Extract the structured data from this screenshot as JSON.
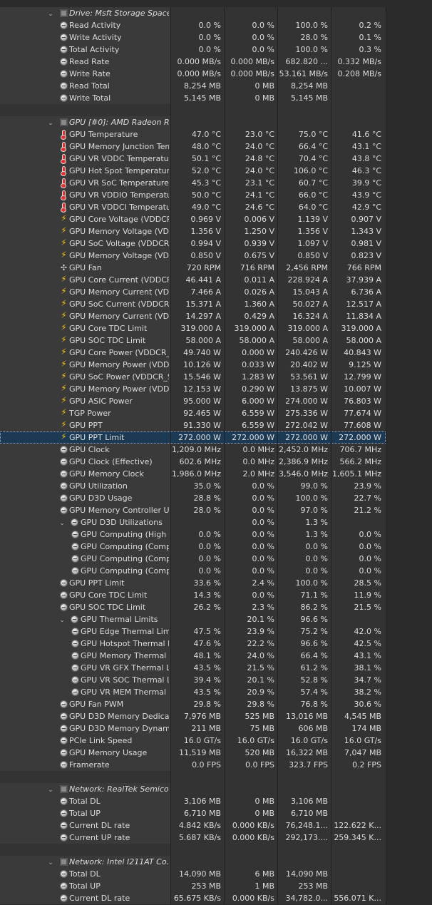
{
  "rows": [
    {
      "t": "section",
      "name": "Drive: Msft Storage Space...",
      "icon": "drive-icon"
    },
    {
      "t": "item",
      "icon": "sensor-circle-icon",
      "name": "Read Activity",
      "v": [
        "0.0 %",
        "0.0 %",
        "100.0 %",
        "0.2 %"
      ]
    },
    {
      "t": "item",
      "icon": "sensor-circle-icon",
      "name": "Write Activity",
      "v": [
        "0.0 %",
        "0.0 %",
        "28.0 %",
        "0.1 %"
      ]
    },
    {
      "t": "item",
      "icon": "sensor-circle-icon",
      "name": "Total Activity",
      "v": [
        "0.0 %",
        "0.0 %",
        "100.0 %",
        "0.3 %"
      ]
    },
    {
      "t": "item",
      "icon": "sensor-circle-icon",
      "name": "Read Rate",
      "v": [
        "0.000 MB/s",
        "0.000 MB/s",
        "682.820 ...",
        "0.332 MB/s"
      ]
    },
    {
      "t": "item",
      "icon": "sensor-circle-icon",
      "name": "Write Rate",
      "v": [
        "0.000 MB/s",
        "0.000 MB/s",
        "53.161 MB/s",
        "0.208 MB/s"
      ]
    },
    {
      "t": "item",
      "icon": "sensor-circle-icon",
      "name": "Read Total",
      "v": [
        "8,254 MB",
        "0 MB",
        "8,254 MB",
        ""
      ]
    },
    {
      "t": "item",
      "icon": "sensor-circle-icon",
      "name": "Write Total",
      "v": [
        "5,145 MB",
        "0 MB",
        "5,145 MB",
        ""
      ]
    },
    {
      "t": "blank"
    },
    {
      "t": "section",
      "name": "GPU [#0]: AMD Radeon R...",
      "icon": "gpu-chip-icon"
    },
    {
      "t": "item",
      "icon": "thermometer-icon",
      "name": "GPU Temperature",
      "v": [
        "47.0 °C",
        "23.0 °C",
        "75.0 °C",
        "41.6 °C"
      ]
    },
    {
      "t": "item",
      "icon": "thermometer-icon",
      "name": "GPU Memory Junction Tem...",
      "v": [
        "48.0 °C",
        "24.0 °C",
        "66.4 °C",
        "43.1 °C"
      ]
    },
    {
      "t": "item",
      "icon": "thermometer-icon",
      "name": "GPU VR VDDC Temperature",
      "v": [
        "50.1 °C",
        "24.8 °C",
        "70.4 °C",
        "43.8 °C"
      ]
    },
    {
      "t": "item",
      "icon": "thermometer-icon",
      "name": "GPU Hot Spot Temperature",
      "v": [
        "52.0 °C",
        "24.0 °C",
        "106.0 °C",
        "46.3 °C"
      ]
    },
    {
      "t": "item",
      "icon": "thermometer-icon",
      "name": "GPU VR SoC Temperature",
      "v": [
        "45.3 °C",
        "23.1 °C",
        "60.7 °C",
        "39.9 °C"
      ]
    },
    {
      "t": "item",
      "icon": "thermometer-icon",
      "name": "GPU VR VDDIO Temperature",
      "v": [
        "50.0 °C",
        "24.1 °C",
        "66.0 °C",
        "43.9 °C"
      ]
    },
    {
      "t": "item",
      "icon": "thermometer-icon",
      "name": "GPU VR VDDCI Temperature",
      "v": [
        "49.0 °C",
        "24.6 °C",
        "64.0 °C",
        "42.9 °C"
      ]
    },
    {
      "t": "item",
      "icon": "lightning-bolt-icon",
      "name": "GPU Core Voltage (VDDCR...",
      "v": [
        "0.969 V",
        "0.006 V",
        "1.139 V",
        "0.907 V"
      ]
    },
    {
      "t": "item",
      "icon": "lightning-bolt-icon",
      "name": "GPU Memory Voltage (VDD...",
      "v": [
        "1.356 V",
        "1.250 V",
        "1.356 V",
        "1.343 V"
      ]
    },
    {
      "t": "item",
      "icon": "lightning-bolt-icon",
      "name": "GPU SoC Voltage (VDDCR_...",
      "v": [
        "0.994 V",
        "0.939 V",
        "1.097 V",
        "0.981 V"
      ]
    },
    {
      "t": "item",
      "icon": "lightning-bolt-icon",
      "name": "GPU Memory Voltage (VDD...",
      "v": [
        "0.850 V",
        "0.675 V",
        "0.850 V",
        "0.823 V"
      ]
    },
    {
      "t": "item",
      "icon": "fan-icon",
      "name": "GPU Fan",
      "v": [
        "720 RPM",
        "716 RPM",
        "2,456 RPM",
        "766 RPM"
      ]
    },
    {
      "t": "item",
      "icon": "lightning-bolt-icon",
      "name": "GPU Core Current (VDDCR...",
      "v": [
        "46.441 A",
        "0.011 A",
        "228.924 A",
        "37.939 A"
      ]
    },
    {
      "t": "item",
      "icon": "lightning-bolt-icon",
      "name": "GPU Memory Current (VDD...",
      "v": [
        "7.466 A",
        "0.026 A",
        "15.043 A",
        "6.736 A"
      ]
    },
    {
      "t": "item",
      "icon": "lightning-bolt-icon",
      "name": "GPU SoC Current (VDDCR...",
      "v": [
        "15.371 A",
        "1.360 A",
        "50.027 A",
        "12.517 A"
      ]
    },
    {
      "t": "item",
      "icon": "lightning-bolt-icon",
      "name": "GPU Memory Current (VDD...",
      "v": [
        "14.297 A",
        "0.429 A",
        "16.324 A",
        "11.834 A"
      ]
    },
    {
      "t": "item",
      "icon": "lightning-bolt-icon",
      "name": "GPU Core TDC Limit",
      "v": [
        "319.000 A",
        "319.000 A",
        "319.000 A",
        "319.000 A"
      ]
    },
    {
      "t": "item",
      "icon": "lightning-bolt-icon",
      "name": "GPU SOC TDC Limit",
      "v": [
        "58.000 A",
        "58.000 A",
        "58.000 A",
        "58.000 A"
      ]
    },
    {
      "t": "item",
      "icon": "lightning-bolt-icon",
      "name": "GPU Core Power (VDDCR_...",
      "v": [
        "49.740 W",
        "0.000 W",
        "240.426 W",
        "40.843 W"
      ]
    },
    {
      "t": "item",
      "icon": "lightning-bolt-icon",
      "name": "GPU Memory Power (VDDIO)",
      "v": [
        "10.126 W",
        "0.033 W",
        "20.402 W",
        "9.125 W"
      ]
    },
    {
      "t": "item",
      "icon": "lightning-bolt-icon",
      "name": "GPU SoC Power (VDDCR_S...",
      "v": [
        "15.546 W",
        "1.283 W",
        "53.561 W",
        "12.799 W"
      ]
    },
    {
      "t": "item",
      "icon": "lightning-bolt-icon",
      "name": "GPU Memory Power (VDDC...",
      "v": [
        "12.153 W",
        "0.290 W",
        "13.875 W",
        "10.007 W"
      ]
    },
    {
      "t": "item",
      "icon": "lightning-bolt-icon",
      "name": "GPU ASIC Power",
      "v": [
        "95.000 W",
        "6.000 W",
        "274.000 W",
        "76.803 W"
      ]
    },
    {
      "t": "item",
      "icon": "lightning-bolt-icon",
      "name": "TGP Power",
      "v": [
        "92.465 W",
        "6.559 W",
        "275.336 W",
        "77.674 W"
      ]
    },
    {
      "t": "item",
      "icon": "lightning-bolt-icon",
      "name": "GPU PPT",
      "v": [
        "91.330 W",
        "6.559 W",
        "272.042 W",
        "77.608 W"
      ]
    },
    {
      "t": "item",
      "icon": "lightning-bolt-icon",
      "name": "GPU PPT Limit",
      "v": [
        "272.000 W",
        "272.000 W",
        "272.000 W",
        "272.000 W"
      ],
      "selected": true
    },
    {
      "t": "item",
      "icon": "sensor-circle-icon",
      "name": "GPU Clock",
      "v": [
        "1,209.0 MHz",
        "0.0 MHz",
        "2,452.0 MHz",
        "706.7 MHz"
      ]
    },
    {
      "t": "item",
      "icon": "sensor-circle-icon",
      "name": "GPU Clock (Effective)",
      "v": [
        "602.6 MHz",
        "0.0 MHz",
        "2,386.9 MHz",
        "566.2 MHz"
      ]
    },
    {
      "t": "item",
      "icon": "sensor-circle-icon",
      "name": "GPU Memory Clock",
      "v": [
        "1,986.0 MHz",
        "2.0 MHz",
        "3,546.0 MHz",
        "1,605.1 MHz"
      ]
    },
    {
      "t": "item",
      "icon": "sensor-circle-icon",
      "name": "GPU Utilization",
      "v": [
        "35.0 %",
        "0.0 %",
        "99.0 %",
        "23.9 %"
      ]
    },
    {
      "t": "item",
      "icon": "sensor-circle-icon",
      "name": "GPU D3D Usage",
      "v": [
        "28.8 %",
        "0.0 %",
        "100.0 %",
        "22.7 %"
      ]
    },
    {
      "t": "item",
      "icon": "sensor-circle-icon",
      "name": "GPU Memory Controller Uti...",
      "v": [
        "28.0 %",
        "0.0 %",
        "97.0 %",
        "21.2 %"
      ]
    },
    {
      "t": "group",
      "icon": "sensor-circle-icon",
      "name": "GPU D3D Utilizations",
      "v": [
        "",
        "0.0 %",
        "1.3 %",
        ""
      ]
    },
    {
      "t": "sub",
      "icon": "sensor-circle-icon",
      "name": "GPU Computing (High P...",
      "v": [
        "0.0 %",
        "0.0 %",
        "1.3 %",
        "0.0 %"
      ]
    },
    {
      "t": "sub",
      "icon": "sensor-circle-icon",
      "name": "GPU Computing (Comp...",
      "v": [
        "0.0 %",
        "0.0 %",
        "0.0 %",
        "0.0 %"
      ]
    },
    {
      "t": "sub",
      "icon": "sensor-circle-icon",
      "name": "GPU Computing (Comp...",
      "v": [
        "0.0 %",
        "0.0 %",
        "0.0 %",
        "0.0 %"
      ]
    },
    {
      "t": "sub",
      "icon": "sensor-circle-icon",
      "name": "GPU Computing (Comp...",
      "v": [
        "0.0 %",
        "0.0 %",
        "0.0 %",
        "0.0 %"
      ]
    },
    {
      "t": "item",
      "icon": "sensor-circle-icon",
      "name": "GPU PPT Limit",
      "v": [
        "33.6 %",
        "2.4 %",
        "100.0 %",
        "28.5 %"
      ]
    },
    {
      "t": "item",
      "icon": "sensor-circle-icon",
      "name": "GPU Core TDC Limit",
      "v": [
        "14.3 %",
        "0.0 %",
        "71.1 %",
        "11.9 %"
      ]
    },
    {
      "t": "item",
      "icon": "sensor-circle-icon",
      "name": "GPU SOC TDC Limit",
      "v": [
        "26.2 %",
        "2.3 %",
        "86.2 %",
        "21.5 %"
      ]
    },
    {
      "t": "group",
      "icon": "sensor-circle-icon",
      "name": "GPU Thermal Limits",
      "v": [
        "",
        "20.1 %",
        "96.6 %",
        ""
      ]
    },
    {
      "t": "sub",
      "icon": "sensor-circle-icon",
      "name": "GPU Edge Thermal Limit",
      "v": [
        "47.5 %",
        "23.9 %",
        "75.2 %",
        "42.0 %"
      ]
    },
    {
      "t": "sub",
      "icon": "sensor-circle-icon",
      "name": "GPU Hotspot Thermal Li...",
      "v": [
        "47.6 %",
        "22.2 %",
        "96.6 %",
        "42.5 %"
      ]
    },
    {
      "t": "sub",
      "icon": "sensor-circle-icon",
      "name": "GPU Memory Thermal Li...",
      "v": [
        "48.1 %",
        "24.0 %",
        "66.4 %",
        "43.1 %"
      ]
    },
    {
      "t": "sub",
      "icon": "sensor-circle-icon",
      "name": "GPU VR GFX Thermal Limit",
      "v": [
        "43.5 %",
        "21.5 %",
        "61.2 %",
        "38.1 %"
      ]
    },
    {
      "t": "sub",
      "icon": "sensor-circle-icon",
      "name": "GPU VR SOC Thermal Li...",
      "v": [
        "39.4 %",
        "20.1 %",
        "52.8 %",
        "34.7 %"
      ]
    },
    {
      "t": "sub",
      "icon": "sensor-circle-icon",
      "name": "GPU VR MEM Thermal Li...",
      "v": [
        "43.5 %",
        "20.9 %",
        "57.4 %",
        "38.2 %"
      ]
    },
    {
      "t": "item",
      "icon": "sensor-circle-icon",
      "name": "GPU Fan PWM",
      "v": [
        "29.8 %",
        "29.8 %",
        "76.8 %",
        "30.6 %"
      ]
    },
    {
      "t": "item",
      "icon": "sensor-circle-icon",
      "name": "GPU D3D Memory Dedicated",
      "v": [
        "7,976 MB",
        "525 MB",
        "13,016 MB",
        "4,545 MB"
      ]
    },
    {
      "t": "item",
      "icon": "sensor-circle-icon",
      "name": "GPU D3D Memory Dynamic",
      "v": [
        "211 MB",
        "75 MB",
        "606 MB",
        "174 MB"
      ]
    },
    {
      "t": "item",
      "icon": "sensor-circle-icon",
      "name": "PCIe Link Speed",
      "v": [
        "16.0 GT/s",
        "16.0 GT/s",
        "16.0 GT/s",
        "16.0 GT/s"
      ]
    },
    {
      "t": "item",
      "icon": "sensor-circle-icon",
      "name": "GPU Memory Usage",
      "v": [
        "11,519 MB",
        "520 MB",
        "16,322 MB",
        "7,047 MB"
      ]
    },
    {
      "t": "item",
      "icon": "sensor-circle-icon",
      "name": "Framerate",
      "v": [
        "0.0 FPS",
        "0.0 FPS",
        "323.7 FPS",
        "0.2 FPS"
      ]
    },
    {
      "t": "blank"
    },
    {
      "t": "section",
      "name": "Network: RealTek Semicon...",
      "icon": "network-icon"
    },
    {
      "t": "item",
      "icon": "sensor-circle-icon",
      "name": "Total DL",
      "v": [
        "3,106 MB",
        "0 MB",
        "3,106 MB",
        ""
      ]
    },
    {
      "t": "item",
      "icon": "sensor-circle-icon",
      "name": "Total UP",
      "v": [
        "6,710 MB",
        "0 MB",
        "6,710 MB",
        ""
      ]
    },
    {
      "t": "item",
      "icon": "sensor-circle-icon",
      "name": "Current DL rate",
      "v": [
        "4.842 KB/s",
        "0.000 KB/s",
        "76,248.1...",
        "122.622 K..."
      ]
    },
    {
      "t": "item",
      "icon": "sensor-circle-icon",
      "name": "Current UP rate",
      "v": [
        "5.687 KB/s",
        "0.000 KB/s",
        "292,173....",
        "259.345 K..."
      ]
    },
    {
      "t": "blank"
    },
    {
      "t": "section",
      "name": "Network: Intel I211AT Co...",
      "icon": "network-icon"
    },
    {
      "t": "item",
      "icon": "sensor-circle-icon",
      "name": "Total DL",
      "v": [
        "14,090 MB",
        "6 MB",
        "14,090 MB",
        ""
      ]
    },
    {
      "t": "item",
      "icon": "sensor-circle-icon",
      "name": "Total UP",
      "v": [
        "253 MB",
        "1 MB",
        "253 MB",
        ""
      ]
    },
    {
      "t": "item",
      "icon": "sensor-circle-icon",
      "name": "Current DL rate",
      "v": [
        "65.675 KB/s",
        "0.000 KB/s",
        "34,782.0...",
        "556.071 K..."
      ]
    }
  ],
  "expander_collapse_glyph": "⌄",
  "icon_glyphs": {
    "bolt": "⚡",
    "fan": "✣"
  },
  "colors": {
    "background": "#2b2b2b",
    "text": "#dcdcdc",
    "bolt": "#f5c518",
    "thermometer": "#e03030",
    "selected": "#1d3a55"
  }
}
